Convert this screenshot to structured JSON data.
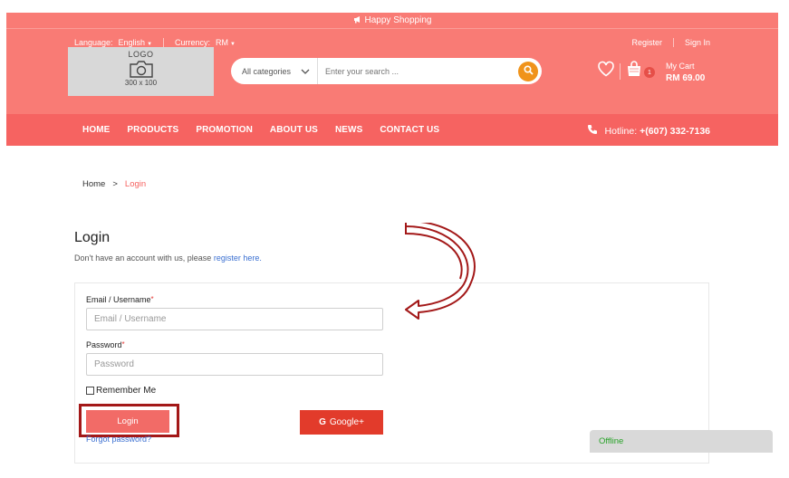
{
  "topbar": {
    "text": "Happy Shopping",
    "icon": "megaphone-icon"
  },
  "langbar": {
    "language_label": "Language:",
    "language_value": "English",
    "currency_label": "Currency:",
    "currency_value": "RM",
    "register": "Register",
    "signin": "Sign In"
  },
  "logo": {
    "title": "LOGO",
    "size": "300 x 100",
    "icon": "camera-icon"
  },
  "search": {
    "category": "All categories",
    "placeholder": "Enter your search ...",
    "icon": "search-icon"
  },
  "cart": {
    "badge": "1",
    "label": "My Cart",
    "amount": "RM 69.00",
    "wishlist_icon": "heart-icon",
    "cart_icon": "shopping-bag-icon"
  },
  "nav": {
    "items": [
      "HOME",
      "PRODUCTS",
      "PROMOTION",
      "ABOUT US",
      "NEWS",
      "CONTACT US"
    ],
    "hotline_label": "Hotline:",
    "hotline_number": "+(607) 332-7136",
    "phone_icon": "phone-icon"
  },
  "breadcrumb": {
    "home": "Home",
    "sep": ">",
    "current": "Login"
  },
  "login": {
    "title": "Login",
    "subtitle": "Don't have an account with us, please",
    "register_link": "register here.",
    "email_label": "Email / Username",
    "email_placeholder": "Email / Username",
    "password_label": "Password",
    "password_placeholder": "Password",
    "required_mark": "*",
    "remember": "Remember Me",
    "login_button": "Login",
    "forgot": "Forgot password?",
    "google_button": "Google+",
    "google_icon": "google-g-icon"
  },
  "chat": {
    "status": "Offline"
  },
  "colors": {
    "header": "#f97b75",
    "nav": "#f66361",
    "accent": "#f0931b",
    "annotation": "#a31818",
    "google": "#e23b2b"
  }
}
